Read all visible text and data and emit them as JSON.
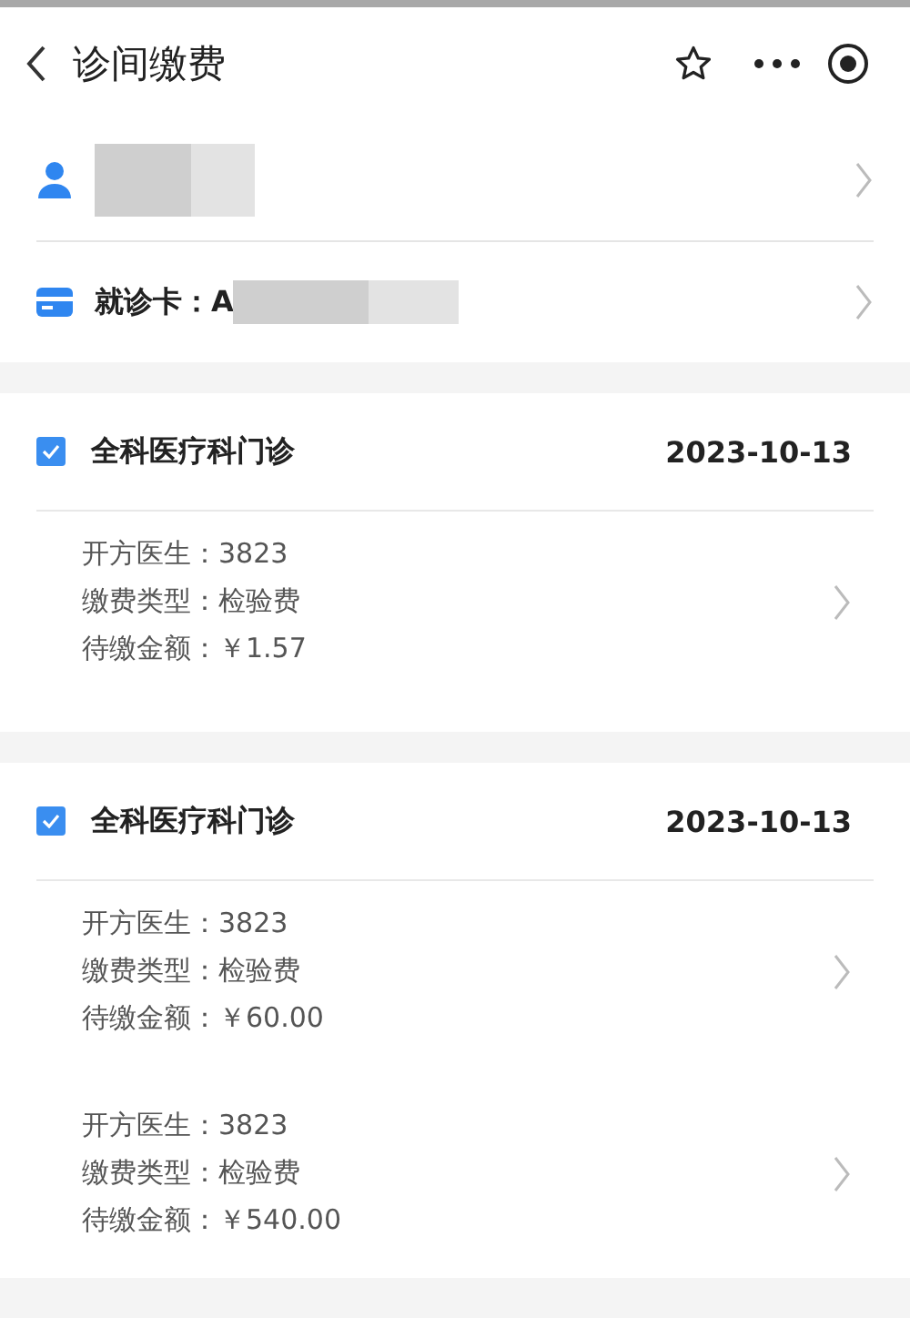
{
  "header": {
    "title": "诊间缴费"
  },
  "patient": {
    "redacted": true
  },
  "card": {
    "label": "就诊卡：A",
    "redacted": true
  },
  "visits": [
    {
      "department": "全科医疗科门诊",
      "date": "2023-10-13",
      "checked": true,
      "fees": [
        [
          "开方医生：3823",
          "缴费类型：检验费",
          "待缴金额：￥1.57"
        ]
      ]
    },
    {
      "department": "全科医疗科门诊",
      "date": "2023-10-13",
      "checked": true,
      "fees": [
        [
          "开方医生：3823",
          "缴费类型：检验费",
          "待缴金额：￥60.00"
        ],
        [
          "开方医生：3823",
          "缴费类型：检验费",
          "待缴金额：￥540.00"
        ]
      ]
    }
  ]
}
